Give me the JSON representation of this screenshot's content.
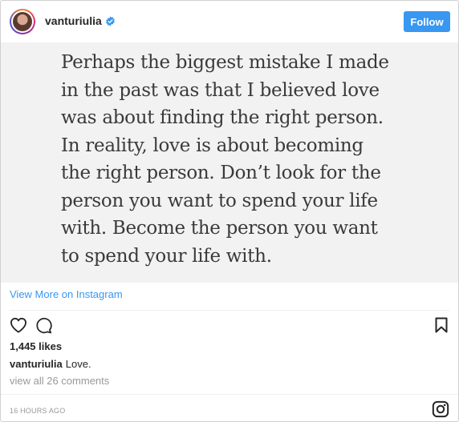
{
  "header": {
    "username": "vanturiulia",
    "follow_label": "Follow"
  },
  "post": {
    "quote_text": "Perhaps the biggest mistake I made\nin the past was that I believed love\nwas about finding the right person.\nIn reality, love is about becoming\nthe right person. Don’t look for the\nperson you want to spend your life\nwith. Become the person you want\nto spend your life with."
  },
  "view_more_label": "View More on Instagram",
  "actions": {
    "like_icon": "heart-icon",
    "comment_icon": "comment-icon",
    "save_icon": "bookmark-icon"
  },
  "likes_text": "1,445 likes",
  "caption": {
    "username": "vanturiulia",
    "text": "Love."
  },
  "comments_link": "view all 26 comments",
  "timestamp": "16 HOURS AGO",
  "colors": {
    "accent": "#3897f0",
    "text": "#262626",
    "muted": "#999999"
  }
}
